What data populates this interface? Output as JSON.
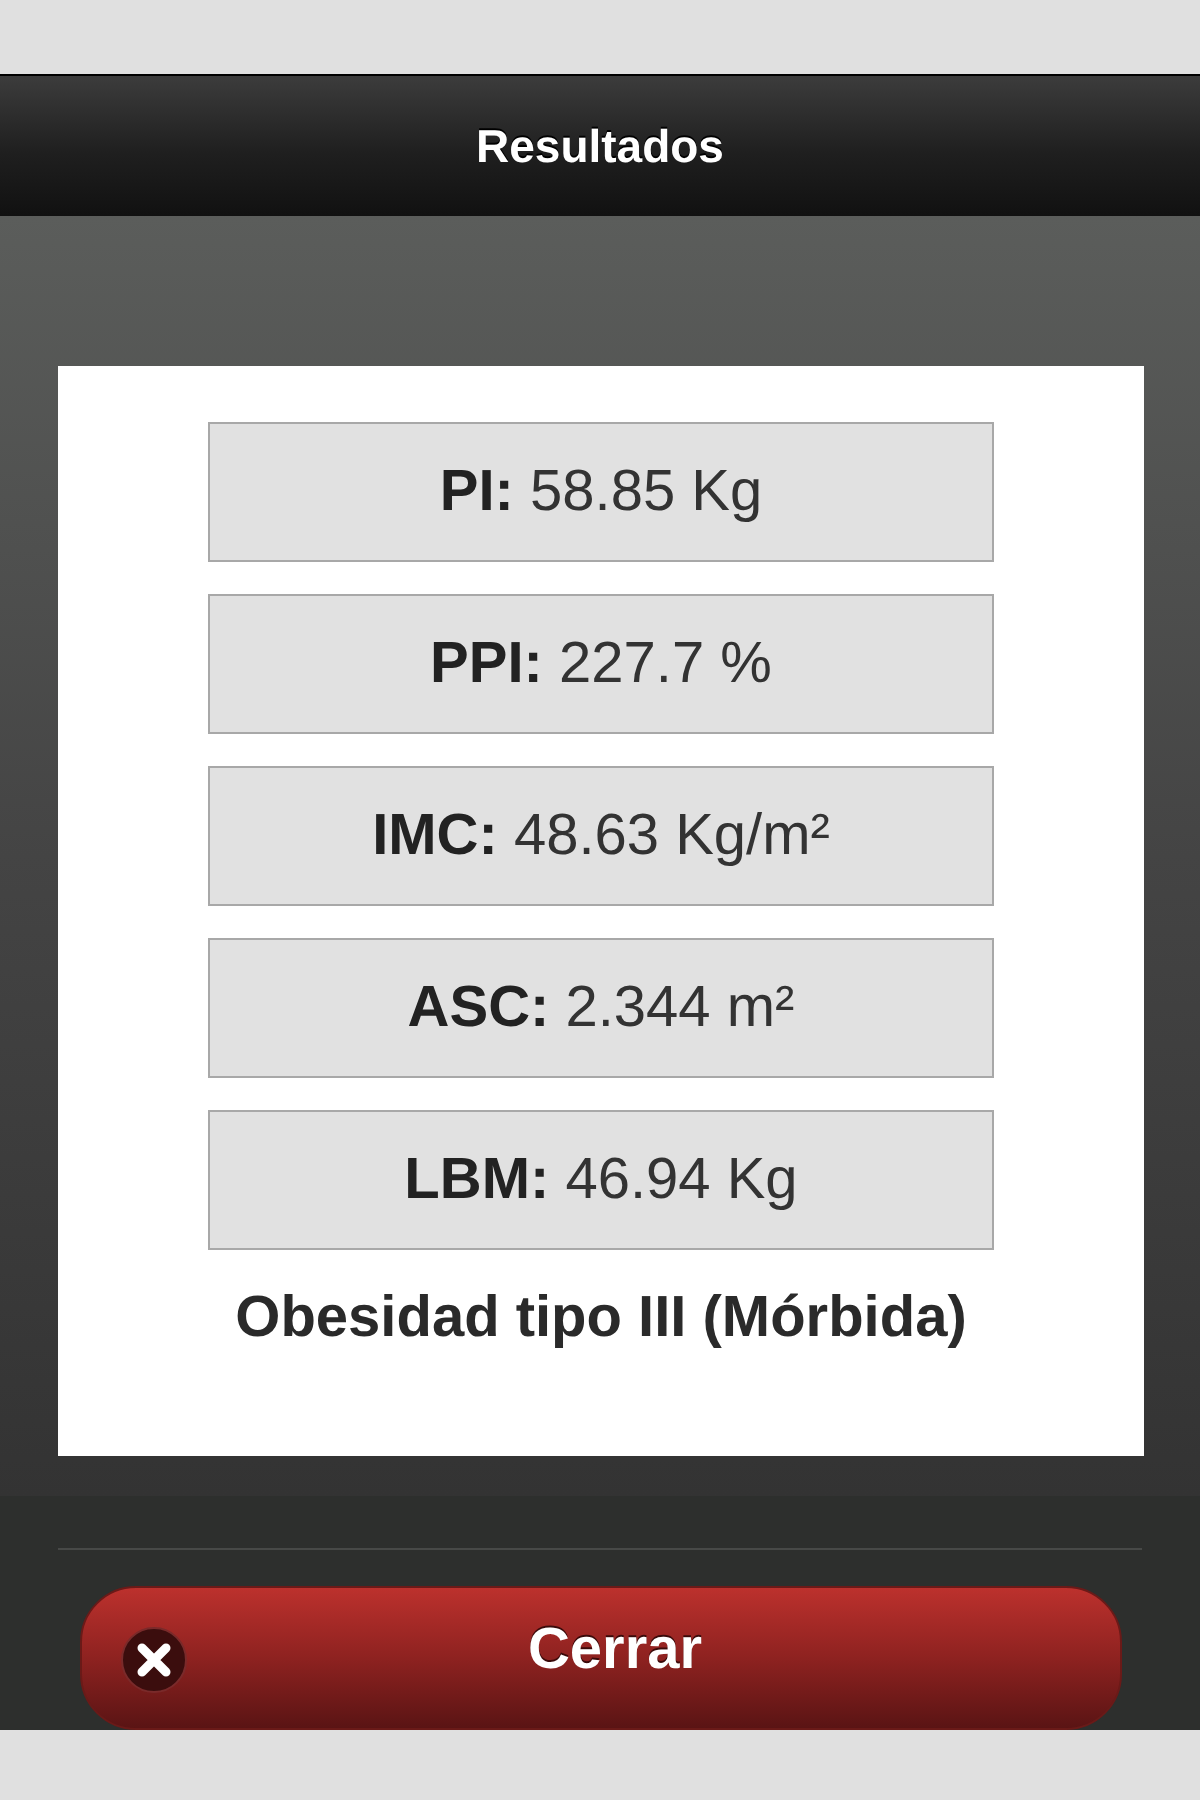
{
  "header": {
    "title": "Resultados"
  },
  "results": [
    {
      "text": "**PI:** 58.85 Kg"
    },
    {
      "text": "**PPI:** 227.7 %"
    },
    {
      "text": "**IMC:** 48.63 Kg/m²"
    },
    {
      "text": "**ASC:** 2.344 m²"
    },
    {
      "text": "**LBM:** 46.94 Kg"
    }
  ],
  "classification": "Obesidad tipo III (Mórbida)",
  "close_button": {
    "label": "Cerrar"
  }
}
